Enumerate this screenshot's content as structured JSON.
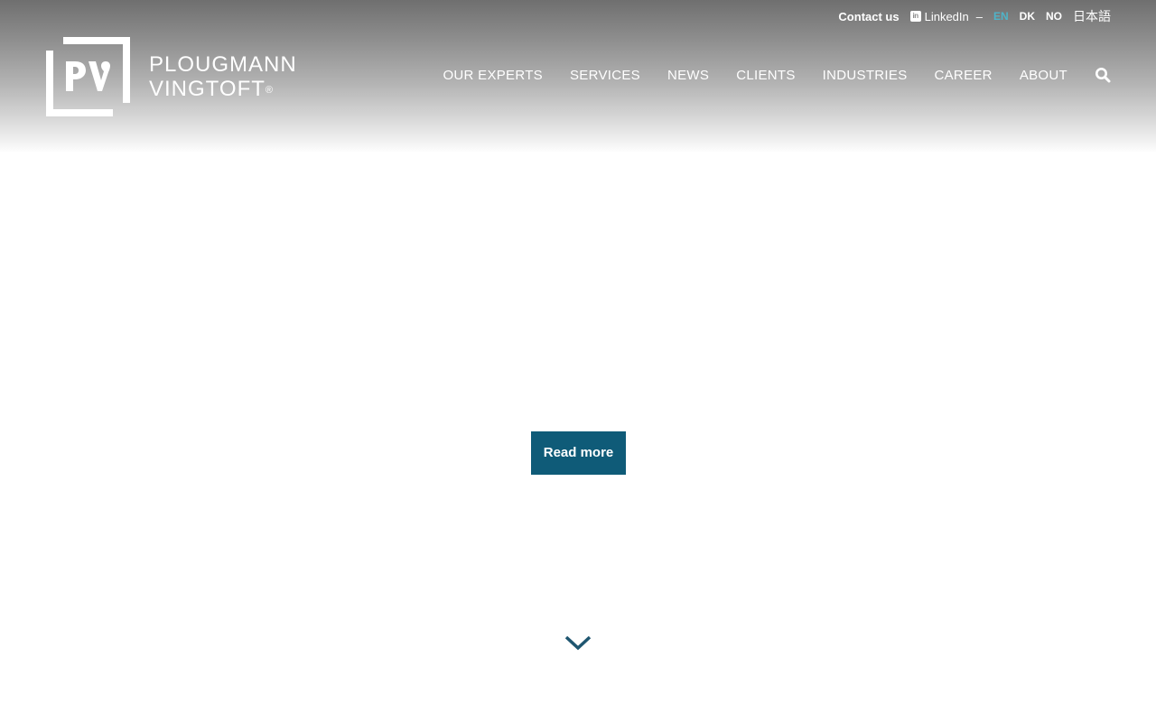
{
  "topbar": {
    "contact_label": "Contact us",
    "linkedin_label": "LinkedIn",
    "separator": "–",
    "languages": [
      {
        "code": "EN",
        "active": true
      },
      {
        "code": "DK",
        "active": false
      },
      {
        "code": "NO",
        "active": false
      },
      {
        "code": "日本語",
        "active": false
      }
    ]
  },
  "logo": {
    "line1": "PLOUGMANN",
    "line2": "VINGTOFT",
    "registered": "®",
    "mark": "PV"
  },
  "nav": {
    "items": [
      {
        "label": "OUR EXPERTS"
      },
      {
        "label": "SERVICES"
      },
      {
        "label": "NEWS"
      },
      {
        "label": "CLIENTS"
      },
      {
        "label": "INDUSTRIES"
      },
      {
        "label": "CAREER"
      },
      {
        "label": "ABOUT"
      }
    ],
    "search_icon": "search-icon"
  },
  "hero": {
    "cta_label": "Read more",
    "scroll_icon": "chevron-down-icon"
  },
  "colors": {
    "accent": "#0f5b78",
    "active_language": "#4fb3c8",
    "chevron": "#1f5670"
  }
}
